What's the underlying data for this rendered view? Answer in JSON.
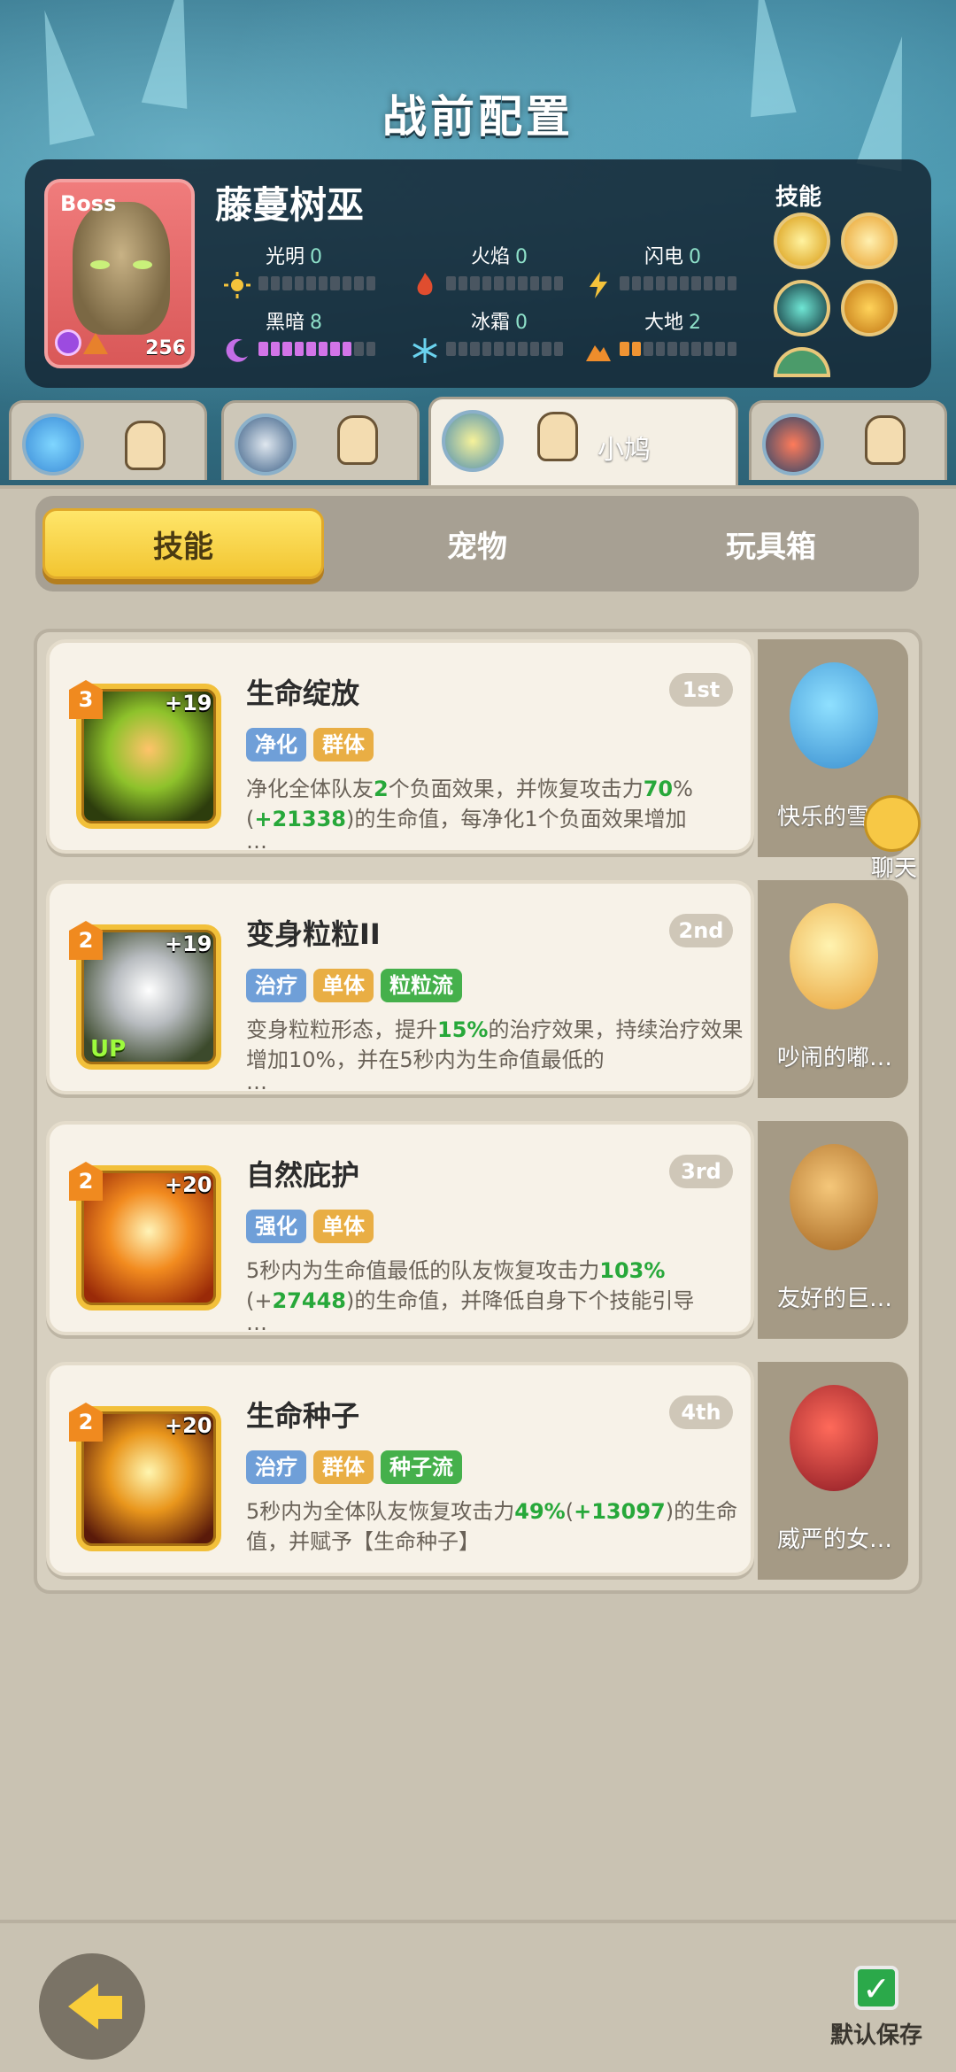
{
  "header": {
    "title": "战前配置"
  },
  "boss": {
    "tag": "Boss",
    "name": "藤蔓树巫",
    "level": "256",
    "skills_label": "技能",
    "elements": [
      {
        "name": "光明",
        "value": "0",
        "color": "#f4c33b",
        "filled": 0
      },
      {
        "name": "火焰",
        "value": "0",
        "color": "#e04d2f",
        "filled": 0
      },
      {
        "name": "闪电",
        "value": "0",
        "color": "#f4c33b",
        "filled": 0
      },
      {
        "name": "黑暗",
        "value": "8",
        "color": "#c46ee6",
        "filled": 8
      },
      {
        "name": "冰霜",
        "value": "0",
        "color": "#6ad3ef",
        "filled": 0
      },
      {
        "name": "大地",
        "value": "2",
        "color": "#ee8d2c",
        "filled": 2
      }
    ]
  },
  "team_tabs": [
    {
      "name": "",
      "active": false
    },
    {
      "name": "",
      "active": false
    },
    {
      "name": "小鸠",
      "active": true
    },
    {
      "name": "",
      "active": false
    }
  ],
  "segments": {
    "skills": "技能",
    "pets": "宠物",
    "toybox": "玩具箱"
  },
  "cards": [
    {
      "title": "生命绽放",
      "rank": "1st",
      "level": "3",
      "plus": "+19",
      "tags": [
        "净化",
        "群体"
      ],
      "desc_html_parts": [
        "净化全体队友",
        "2",
        "个负面效果，并恢复攻击力",
        "70",
        "%(",
        "+21338",
        ")的生命值，每净化1个负面效果增加"
      ],
      "ellipsis": "…",
      "pet_name": "快乐的雪…"
    },
    {
      "title": "变身粒粒II",
      "rank": "2nd",
      "level": "2",
      "plus": "+19",
      "up": "UP",
      "tags": [
        "治疗",
        "单体",
        "粒粒流"
      ],
      "desc_html_parts": [
        "变身粒粒形态，提升",
        "15%",
        "的治疗效果，持续治疗效果增加10%，并在5秒内为生命值最低的"
      ],
      "ellipsis": "…",
      "pet_name": "吵闹的嘟…"
    },
    {
      "title": "自然庇护",
      "rank": "3rd",
      "level": "2",
      "plus": "+20",
      "tags": [
        "强化",
        "单体"
      ],
      "desc_html_parts": [
        "5秒内为生命值最低的队友恢复攻击力",
        "103%",
        "(+",
        "27448",
        ")的生命值，并降低自身下个技能引导"
      ],
      "ellipsis": "…",
      "pet_name": "友好的巨…"
    },
    {
      "title": "生命种子",
      "rank": "4th",
      "level": "2",
      "plus": "+20",
      "tags": [
        "治疗",
        "群体",
        "种子流"
      ],
      "desc_html_parts": [
        "5秒内为全体队友恢复攻击力",
        "49%",
        "(",
        "+13097",
        ")的生命值，并赋予【生命种子】"
      ],
      "ellipsis": "",
      "pet_name": "威严的女…"
    }
  ],
  "chat": {
    "label": "聊天"
  },
  "footer": {
    "save_label": "默认保存"
  }
}
